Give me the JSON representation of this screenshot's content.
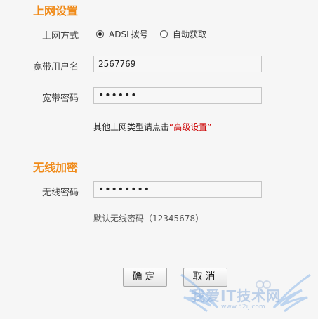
{
  "internet": {
    "title": "上网设置",
    "mode_label": "上网方式",
    "modes": [
      {
        "label": "ADSL拨号",
        "selected": true
      },
      {
        "label": "自动获取",
        "selected": false
      }
    ],
    "username_label": "宽带用户名",
    "username_value": "2567769",
    "password_label": "宽带密码",
    "password_value": "******",
    "hint_prefix": "其他上网类型请点击",
    "hint_open_quote": "“",
    "hint_link": "高级设置",
    "hint_close_quote": "”"
  },
  "wireless": {
    "title": "无线加密",
    "password_label": "无线密码",
    "password_value": "********",
    "default_note": "默认无线密码（12345678）"
  },
  "buttons": {
    "ok": "确定",
    "cancel": "取消"
  },
  "watermark": {
    "text": "我爱IT技术网",
    "url": "www.52ij.com"
  }
}
